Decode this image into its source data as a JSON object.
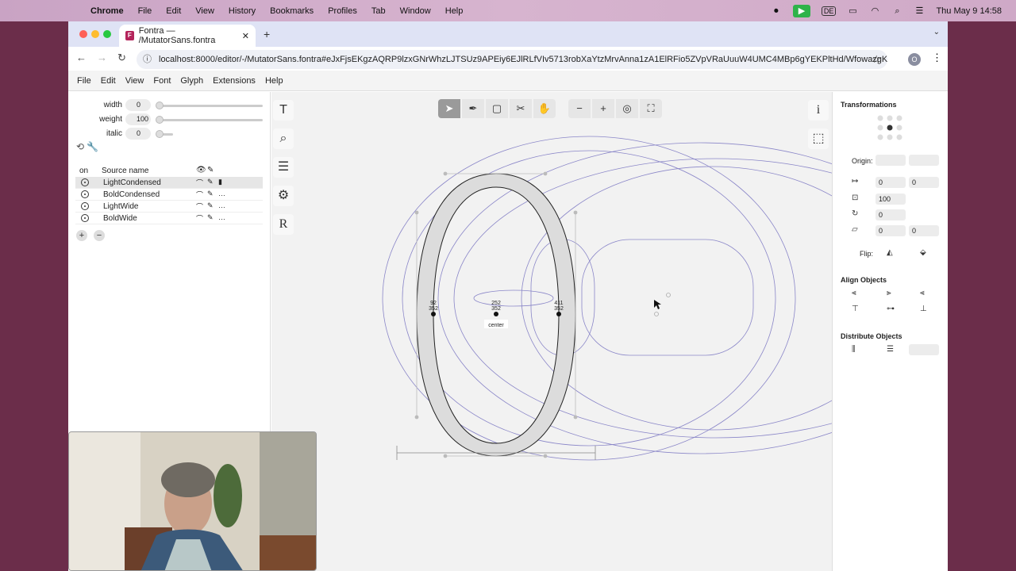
{
  "menubar": {
    "app": "Chrome",
    "items": [
      "File",
      "Edit",
      "View",
      "History",
      "Bookmarks",
      "Profiles",
      "Tab",
      "Window",
      "Help"
    ],
    "input_source": "DE",
    "clock": "Thu May 9  14:58"
  },
  "browser": {
    "tab_title": "Fontra — /MutatorSans.fontra",
    "url": "localhost:8000/editor/-/MutatorSans.fontra#eJxFjsEKgzAQRP9lzxGNrWhzLJTSUz9APEiy6EJlRLfVIv5713robXaYtzMrvAnna1zA1ElRFio5ZVpVRaUuuW4UMC4MBp6gYEKPltHd/WfowazgKe",
    "profile_initial": "O"
  },
  "app_menu": [
    "File",
    "Edit",
    "View",
    "Font",
    "Glyph",
    "Extensions",
    "Help"
  ],
  "axes": [
    {
      "label": "width",
      "value": "0"
    },
    {
      "label": "weight",
      "value": "100"
    },
    {
      "label": "italic",
      "value": "0"
    }
  ],
  "sources": {
    "header_on": "on",
    "header_name": "Source name",
    "rows": [
      {
        "name": "LightCondensed",
        "selected": true
      },
      {
        "name": "BoldCondensed",
        "selected": false
      },
      {
        "name": "LightWide",
        "selected": false
      },
      {
        "name": "BoldWide",
        "selected": false
      }
    ]
  },
  "canvas": {
    "points": [
      {
        "label_a": "92",
        "label_b": "352"
      },
      {
        "label_a": "252",
        "label_b": "352"
      },
      {
        "label_a": "411",
        "label_b": "352"
      }
    ],
    "center_label": "center"
  },
  "right_panel": {
    "title": "Transformations",
    "origin_label": "Origin:",
    "translate": [
      "0",
      "0"
    ],
    "scale": "100",
    "rotate": "0",
    "skew": [
      "0",
      "0"
    ],
    "flip_label": "Flip:",
    "align_title": "Align Objects",
    "distribute_title": "Distribute Objects"
  }
}
